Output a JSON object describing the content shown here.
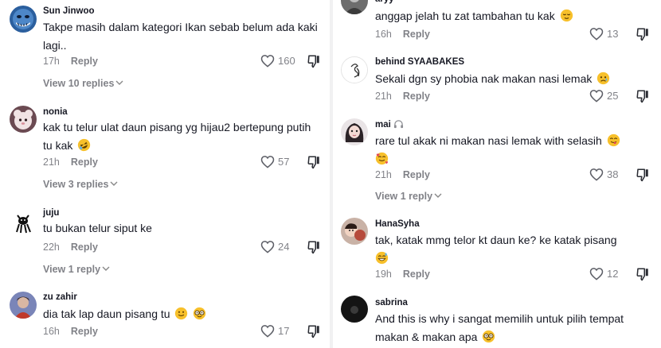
{
  "left": [
    {
      "username": "Sun Jinwoo",
      "text": "Takpe masih dalam kategori Ikan sebab belum ada kaki lagi..",
      "emojis": [],
      "time": "17h",
      "reply": "Reply",
      "likes": "160",
      "view_replies": "View 10 replies"
    },
    {
      "username": "nonia",
      "text": "kak tu telur ulat daun pisang yg hijau2 bertepung putih tu kak",
      "emojis": [
        "rofl"
      ],
      "time": "21h",
      "reply": "Reply",
      "likes": "57",
      "view_replies": "View 3 replies"
    },
    {
      "username": "juju",
      "text": "tu bukan telur siput ke",
      "emojis": [],
      "time": "22h",
      "reply": "Reply",
      "likes": "24",
      "view_replies": "View 1 reply"
    },
    {
      "username": "zu zahir",
      "text": "dia tak lap daun pisang tu",
      "emojis": [
        "slight-smile",
        "nerd"
      ],
      "time": "16h",
      "reply": "Reply",
      "likes": "17"
    }
  ],
  "right": [
    {
      "username": "aryy",
      "text": "anggap jelah tu zat tambahan tu kak",
      "emojis": [
        "relieved"
      ],
      "time": "16h",
      "reply": "Reply",
      "likes": "13"
    },
    {
      "username": "behind SYAABAKES",
      "text": "Sekali dgn sy phobia nak makan nasi lemak",
      "emojis": [
        "sad"
      ],
      "time": "21h",
      "reply": "Reply",
      "likes": "25"
    },
    {
      "username": "mai",
      "text": "rare tul akak ni makan nasi lemak with selasih",
      "emojis": [
        "yum",
        "smiling-hearts"
      ],
      "time": "21h",
      "reply": "Reply",
      "likes": "38",
      "view_replies": "View 1 reply"
    },
    {
      "username": "HanaSyha",
      "text": "tak, katak mmg telor kt daun ke? ke katak pisang",
      "emojis": [
        "grin-sweat"
      ],
      "time": "19h",
      "reply": "Reply",
      "likes": "12"
    },
    {
      "username": "sabrina",
      "text": "And this is why i sangat memilih untuk pilih tempat makan & makan apa",
      "emojis": [
        "nerd"
      ]
    }
  ]
}
